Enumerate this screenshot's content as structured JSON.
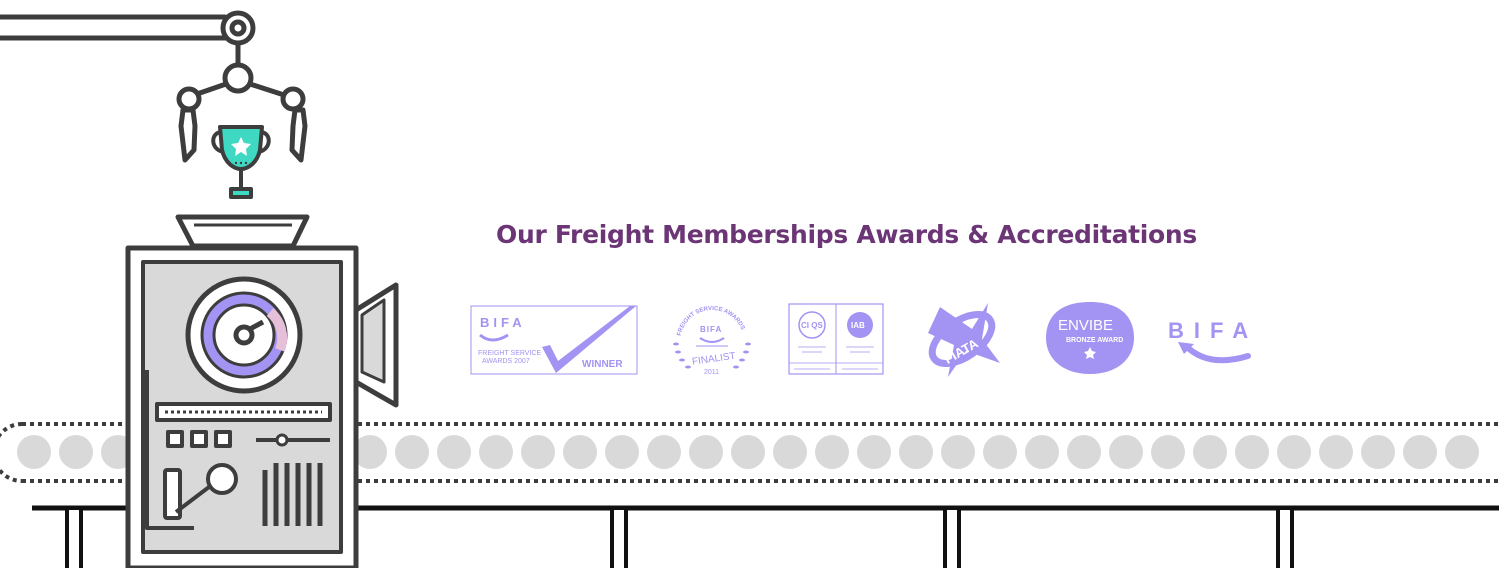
{
  "section": {
    "heading": "Our Freight Memberships Awards & Accreditations"
  },
  "colors": {
    "heading": "#6b3576",
    "logo": "#a393f2",
    "trophy": "#3fd8c3",
    "machine_body": "#d9d9d9",
    "machine_outline": "#3d3d3d",
    "roller": "#d9d9d9",
    "gauge_dial": "#a393f2"
  },
  "icons": {
    "trophy": "trophy-icon",
    "claw": "robotic-claw-icon",
    "machine": "award-machine-icon",
    "conveyor": "conveyor-belt-icon"
  },
  "logos": {
    "bifa_winner": {
      "brand": "BIFA",
      "line1": "FREIGHT SERVICE",
      "line2": "AWARDS 2007",
      "badge": "WINNER"
    },
    "bifa_finalist": {
      "ring_text": "FREIGHT SERVICE AWARDS",
      "brand": "BIFA",
      "label": "FINALIST",
      "year": "2011"
    },
    "iso_certificates": {
      "left_mark": "CI QS",
      "right_mark": "IAB"
    },
    "fiata": {
      "brand": "FIATA"
    },
    "envibe": {
      "brand": "ENVIBE",
      "award": "BRONZE AWARD"
    },
    "bifa_member": {
      "brand": "BIFA"
    }
  }
}
